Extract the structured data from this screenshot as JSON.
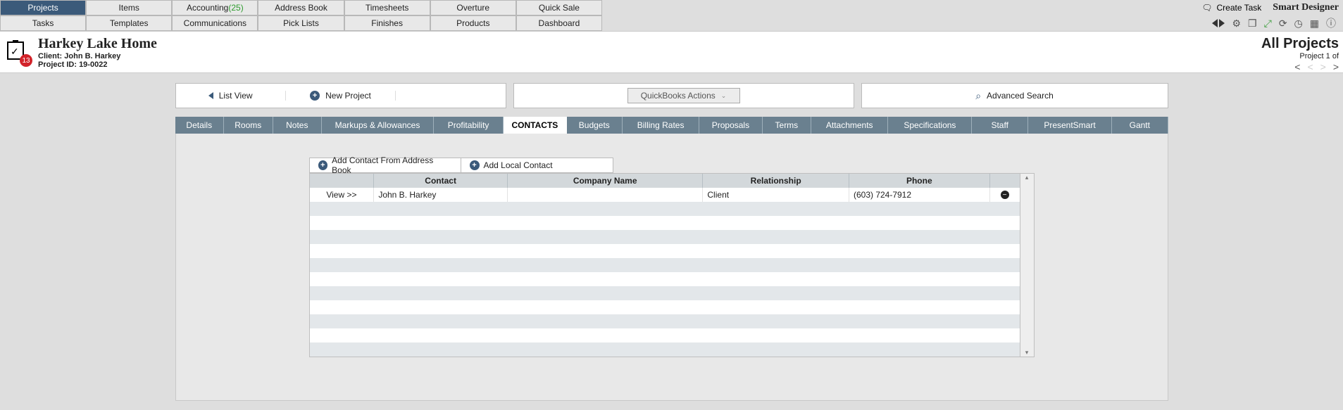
{
  "nav": {
    "row1": [
      "Projects",
      "Items",
      "Accounting",
      "Address Book",
      "Timesheets",
      "Overture",
      "Quick Sale"
    ],
    "row1_badge_index": 2,
    "row1_badge_value": "(25)",
    "row2": [
      "Tasks",
      "Templates",
      "Communications",
      "Pick Lists",
      "Finishes",
      "Products",
      "Dashboard"
    ],
    "active": "Projects"
  },
  "toolbar_right": {
    "create_task": "Create Task",
    "brand": "Smart Designer"
  },
  "project": {
    "title": "Harkey Lake Home",
    "client_label": "Client: John B. Harkey",
    "id_label": "Project ID: 19-0022",
    "badge_count": "13",
    "all_projects": "All Projects",
    "counter": "Project 1 of"
  },
  "actions": {
    "list_view": "List View",
    "new_project": "New Project",
    "quickbooks": "QuickBooks Actions",
    "advanced_search": "Advanced Search"
  },
  "tabs": [
    "Details",
    "Rooms",
    "Notes",
    "Markups & Allowances",
    "Profitability",
    "CONTACTS",
    "Budgets",
    "Billing Rates",
    "Proposals",
    "Terms",
    "Attachments",
    "Specifications",
    "Staff",
    "PresentSmart",
    "Gantt"
  ],
  "tabs_widths": [
    70,
    70,
    70,
    160,
    100,
    90,
    80,
    110,
    90,
    70,
    110,
    120,
    80,
    120,
    80
  ],
  "tabs_active": "CONTACTS",
  "contact_buttons": {
    "from_address_book": "Add Contact From Address Book",
    "add_local": "Add Local Contact"
  },
  "table": {
    "headers": {
      "contact": "Contact",
      "company": "Company Name",
      "relationship": "Relationship",
      "phone": "Phone"
    },
    "rows": [
      {
        "view": "View >>",
        "contact": "John B. Harkey",
        "company": "",
        "relationship": "Client",
        "phone": "(603) 724-7912"
      }
    ]
  }
}
